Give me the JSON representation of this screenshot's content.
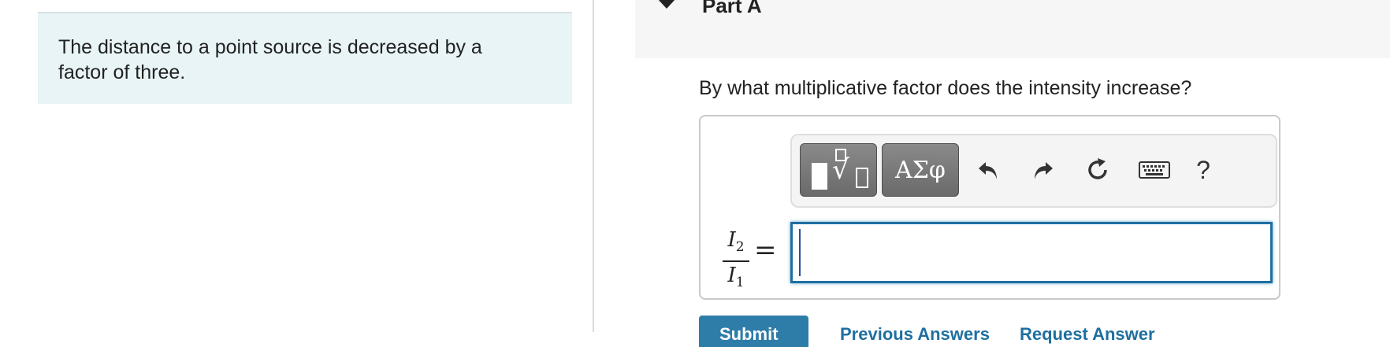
{
  "problem": {
    "text": "The distance to a point source is decreased by a factor of three."
  },
  "part": {
    "title": "Part A",
    "question": "By what multiplicative factor does the intensity increase?"
  },
  "toolbar": {
    "templates_icon": "math-templates-icon",
    "greek_label": "ΑΣφ",
    "undo_icon": "undo-icon",
    "redo_icon": "redo-icon",
    "reset_icon": "reset-icon",
    "keyboard_icon": "keyboard-icon",
    "help_label": "?"
  },
  "equation": {
    "numerator": "I",
    "numerator_sub": "2",
    "denominator": "I",
    "denominator_sub": "1",
    "equals": "="
  },
  "answer": {
    "value": ""
  },
  "buttons": {
    "submit_label": "Submit",
    "previous_answers_label": "Previous Answers",
    "request_answer_label": "Request Answer"
  },
  "colors": {
    "problem_bg": "#e8f4f6",
    "accent": "#2e7da8",
    "input_border": "#1f6fa0"
  }
}
